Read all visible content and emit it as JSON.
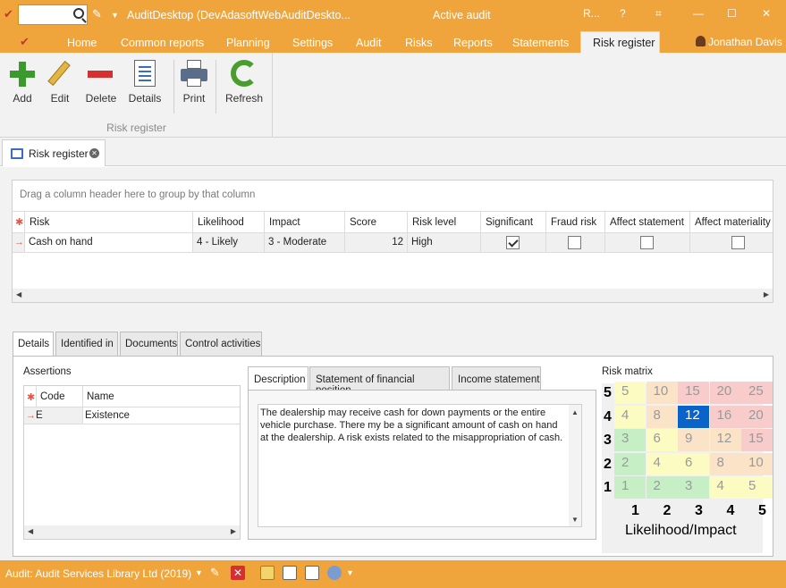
{
  "app": {
    "title": "AuditDesktop (DevAdasoftWebAuditDeskto...",
    "center_title": "Active audit",
    "window_buttons": [
      "R...",
      "?",
      "⌗",
      "—",
      "☐",
      "✕"
    ],
    "user": "Jonathan Davis"
  },
  "menu": [
    "Home",
    "Common reports",
    "Planning",
    "Settings",
    "Audit",
    "Risks",
    "Reports",
    "Statements",
    "Risk register"
  ],
  "ribbon": {
    "buttons": [
      "Add",
      "Edit",
      "Delete",
      "Details",
      "Print",
      "Refresh"
    ],
    "group_label": "Risk register"
  },
  "doc_tab": {
    "label": "Risk register"
  },
  "grid": {
    "group_hint": "Drag a column header here to group by that column",
    "columns": [
      "Risk",
      "Likelihood",
      "Impact",
      "Score",
      "Risk level",
      "Significant",
      "Fraud risk",
      "Affect statement",
      "Affect materiality"
    ],
    "rows": [
      {
        "risk": "Cash on hand",
        "likelihood": "4 - Likely",
        "impact": "3 - Moderate",
        "score": "12",
        "level": "High",
        "significant": true,
        "fraud": false,
        "affect_statement": false,
        "affect_materiality": false
      }
    ]
  },
  "lower_tabs": [
    "Details",
    "Identified in",
    "Documents",
    "Control activities"
  ],
  "assertions": {
    "label": "Assertions",
    "columns": [
      "Code",
      "Name"
    ],
    "rows": [
      {
        "code": "E",
        "name": "Existence"
      }
    ]
  },
  "desc_tabs": [
    "Description",
    "Statement of financial position",
    "Income statement"
  ],
  "description": "The dealership may receive cash for down payments or the entire vehicle purchase. There my be a significant amount of cash on hand at the dealership. A risk exists related to the misappropriation of cash.",
  "risk_matrix": {
    "label": "Risk matrix",
    "rows": [
      5,
      4,
      3,
      2,
      1
    ],
    "cols": [
      1,
      2,
      3,
      4,
      5
    ],
    "values": [
      [
        5,
        10,
        15,
        20,
        25
      ],
      [
        4,
        8,
        12,
        16,
        20
      ],
      [
        3,
        6,
        9,
        12,
        15
      ],
      [
        2,
        4,
        6,
        8,
        10
      ],
      [
        1,
        2,
        3,
        4,
        5
      ]
    ],
    "highlight": {
      "row": 4,
      "col": 3
    },
    "axis_label": "Likelihood/Impact",
    "colors": {
      "green": "#c6efc6",
      "yellow": "#fbfbc2",
      "orange": "#fbe3c8",
      "red": "#f9cccc",
      "highlight": "#0a63c9"
    }
  },
  "status": {
    "text": "Audit: Audit Services Library Ltd (2019)"
  }
}
